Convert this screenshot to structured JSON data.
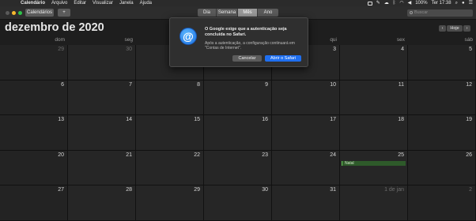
{
  "menubar": {
    "app_name": "Calendário",
    "items": [
      "Arquivo",
      "Editar",
      "Visualizar",
      "Janela",
      "Ajuda"
    ],
    "battery": "100%",
    "clock": "Ter 17:38"
  },
  "toolbar": {
    "calendars_label": "Calendários",
    "add_label": "+",
    "views": [
      "Dia",
      "Semana",
      "Mês",
      "Ano"
    ],
    "active_view": "Mês",
    "search_placeholder": "Buscar"
  },
  "header": {
    "month_title": "dezembro de 2020",
    "prev": "‹",
    "today": "Hoje",
    "next": "›"
  },
  "weekdays": [
    "dom",
    "seg",
    "ter",
    "qua",
    "qui",
    "sex",
    "sáb"
  ],
  "weeks": [
    [
      {
        "d": "29",
        "dim": true
      },
      {
        "d": "30",
        "dim": true
      },
      {
        "d": "1"
      },
      {
        "d": "2"
      },
      {
        "d": "3"
      },
      {
        "d": "4"
      },
      {
        "d": "5"
      }
    ],
    [
      {
        "d": "6"
      },
      {
        "d": "7"
      },
      {
        "d": "8"
      },
      {
        "d": "9"
      },
      {
        "d": "10"
      },
      {
        "d": "11"
      },
      {
        "d": "12"
      }
    ],
    [
      {
        "d": "13"
      },
      {
        "d": "14"
      },
      {
        "d": "15"
      },
      {
        "d": "16"
      },
      {
        "d": "17"
      },
      {
        "d": "18"
      },
      {
        "d": "19"
      }
    ],
    [
      {
        "d": "20"
      },
      {
        "d": "21"
      },
      {
        "d": "22"
      },
      {
        "d": "23"
      },
      {
        "d": "24"
      },
      {
        "d": "25",
        "event": "Natal"
      },
      {
        "d": "26"
      }
    ],
    [
      {
        "d": "27"
      },
      {
        "d": "28"
      },
      {
        "d": "29"
      },
      {
        "d": "30"
      },
      {
        "d": "31"
      },
      {
        "d": "1 de jan",
        "dim": true
      },
      {
        "d": "2",
        "dim": true
      }
    ]
  ],
  "dialog": {
    "title": "O Google exige que a autenticação seja concluída no Safari.",
    "message": "Após a autenticação, a configuração continuará em \"Contas de Internet\".",
    "cancel_label": "Cancelar",
    "ok_label": "Abrir o Safari"
  },
  "colors": {
    "accent": "#1f6ff0",
    "event": "#68c85a"
  }
}
